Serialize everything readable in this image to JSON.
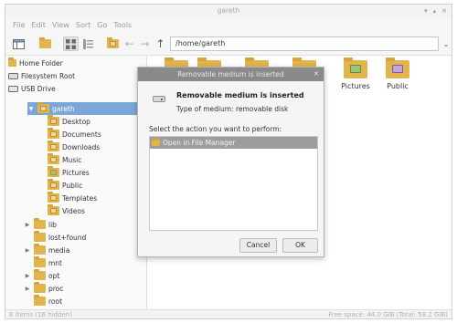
{
  "window": {
    "title": "gareth"
  },
  "menu": [
    "File",
    "Edit",
    "View",
    "Sort",
    "Go",
    "Tools"
  ],
  "toolbar": {
    "path": "/home/gareth"
  },
  "places": [
    "Home Folder",
    "Filesystem Root",
    "USB Drive"
  ],
  "tree": {
    "home": "gareth",
    "home_children": [
      "Desktop",
      "Documents",
      "Downloads",
      "Music",
      "Pictures",
      "Public",
      "Templates",
      "Videos"
    ],
    "root_dirs": [
      "lib",
      "lost+found",
      "media",
      "mnt",
      "opt",
      "proc",
      "root"
    ]
  },
  "content": {
    "items": [
      "Pictures",
      "Public"
    ]
  },
  "status": {
    "left": "8 items (16 hidden)",
    "right": "Free space: 44.0 GiB (Total: 58.2 GiB)"
  },
  "dialog": {
    "title": "Removable medium is inserted",
    "heading": "Removable medium is inserted",
    "media_type": "Type of medium:   removable disk",
    "prompt": "Select the action you want to perform:",
    "option": "Open in File Manager",
    "cancel": "Cancel",
    "ok": "OK"
  },
  "colors": {
    "folder": "#e2b44c",
    "selection": "#7aa6d8",
    "dialog_title": "#8a8a8a"
  }
}
